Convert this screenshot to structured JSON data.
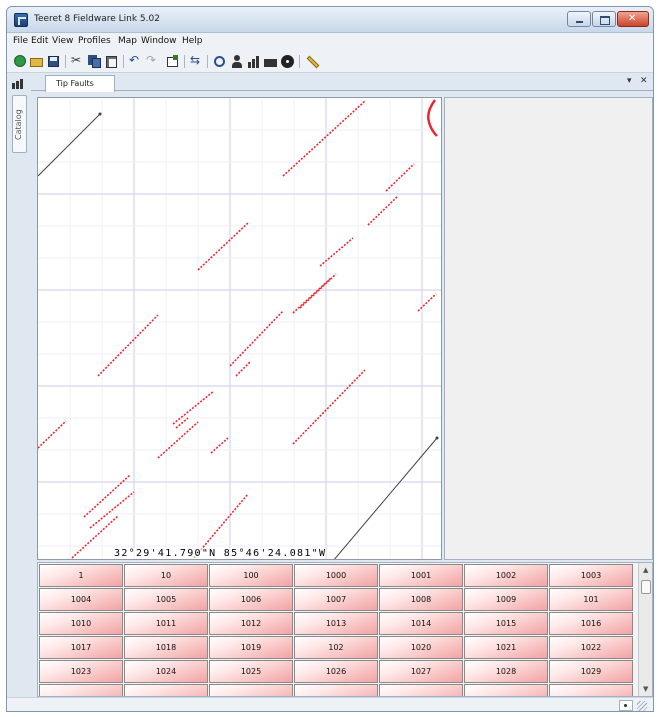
{
  "window": {
    "title": "Teeret 8 Fieldware Link 5.02"
  },
  "menu": [
    "File",
    "Edit",
    "View",
    "Profiles",
    "Map",
    "Window",
    "Help"
  ],
  "toolbar_icons": [
    "new-icon",
    "open-folder-icon",
    "save-icon",
    "cut-icon",
    "copy-icon",
    "paste-icon",
    "undo-icon",
    "redo-icon",
    "properties-icon",
    "transfer-icon",
    "target-icon",
    "user-icon",
    "chart-icon",
    "folder-icon",
    "disc-icon",
    "ruler-icon"
  ],
  "side": {
    "catalog_label": "Catalog"
  },
  "doc_tab": {
    "label": "Tip Faults",
    "pin": "▾",
    "close": "✕"
  },
  "map": {
    "coordinates": "32°29'41.790\"N 85°46'24.081\"W",
    "line_color": "#e8282f",
    "track_color": "#404040"
  },
  "grid_values": [
    [
      "1",
      "10",
      "100",
      "1000",
      "1001",
      "1002",
      "1003"
    ],
    [
      "1004",
      "1005",
      "1006",
      "1007",
      "1008",
      "1009",
      "101"
    ],
    [
      "1010",
      "1011",
      "1012",
      "1013",
      "1014",
      "1015",
      "1016"
    ],
    [
      "1017",
      "1018",
      "1019",
      "102",
      "1020",
      "1021",
      "1022"
    ],
    [
      "1023",
      "1024",
      "1025",
      "1026",
      "1027",
      "1028",
      "1029"
    ],
    [
      "",
      "",
      "",
      "",
      "",
      "",
      ""
    ]
  ]
}
